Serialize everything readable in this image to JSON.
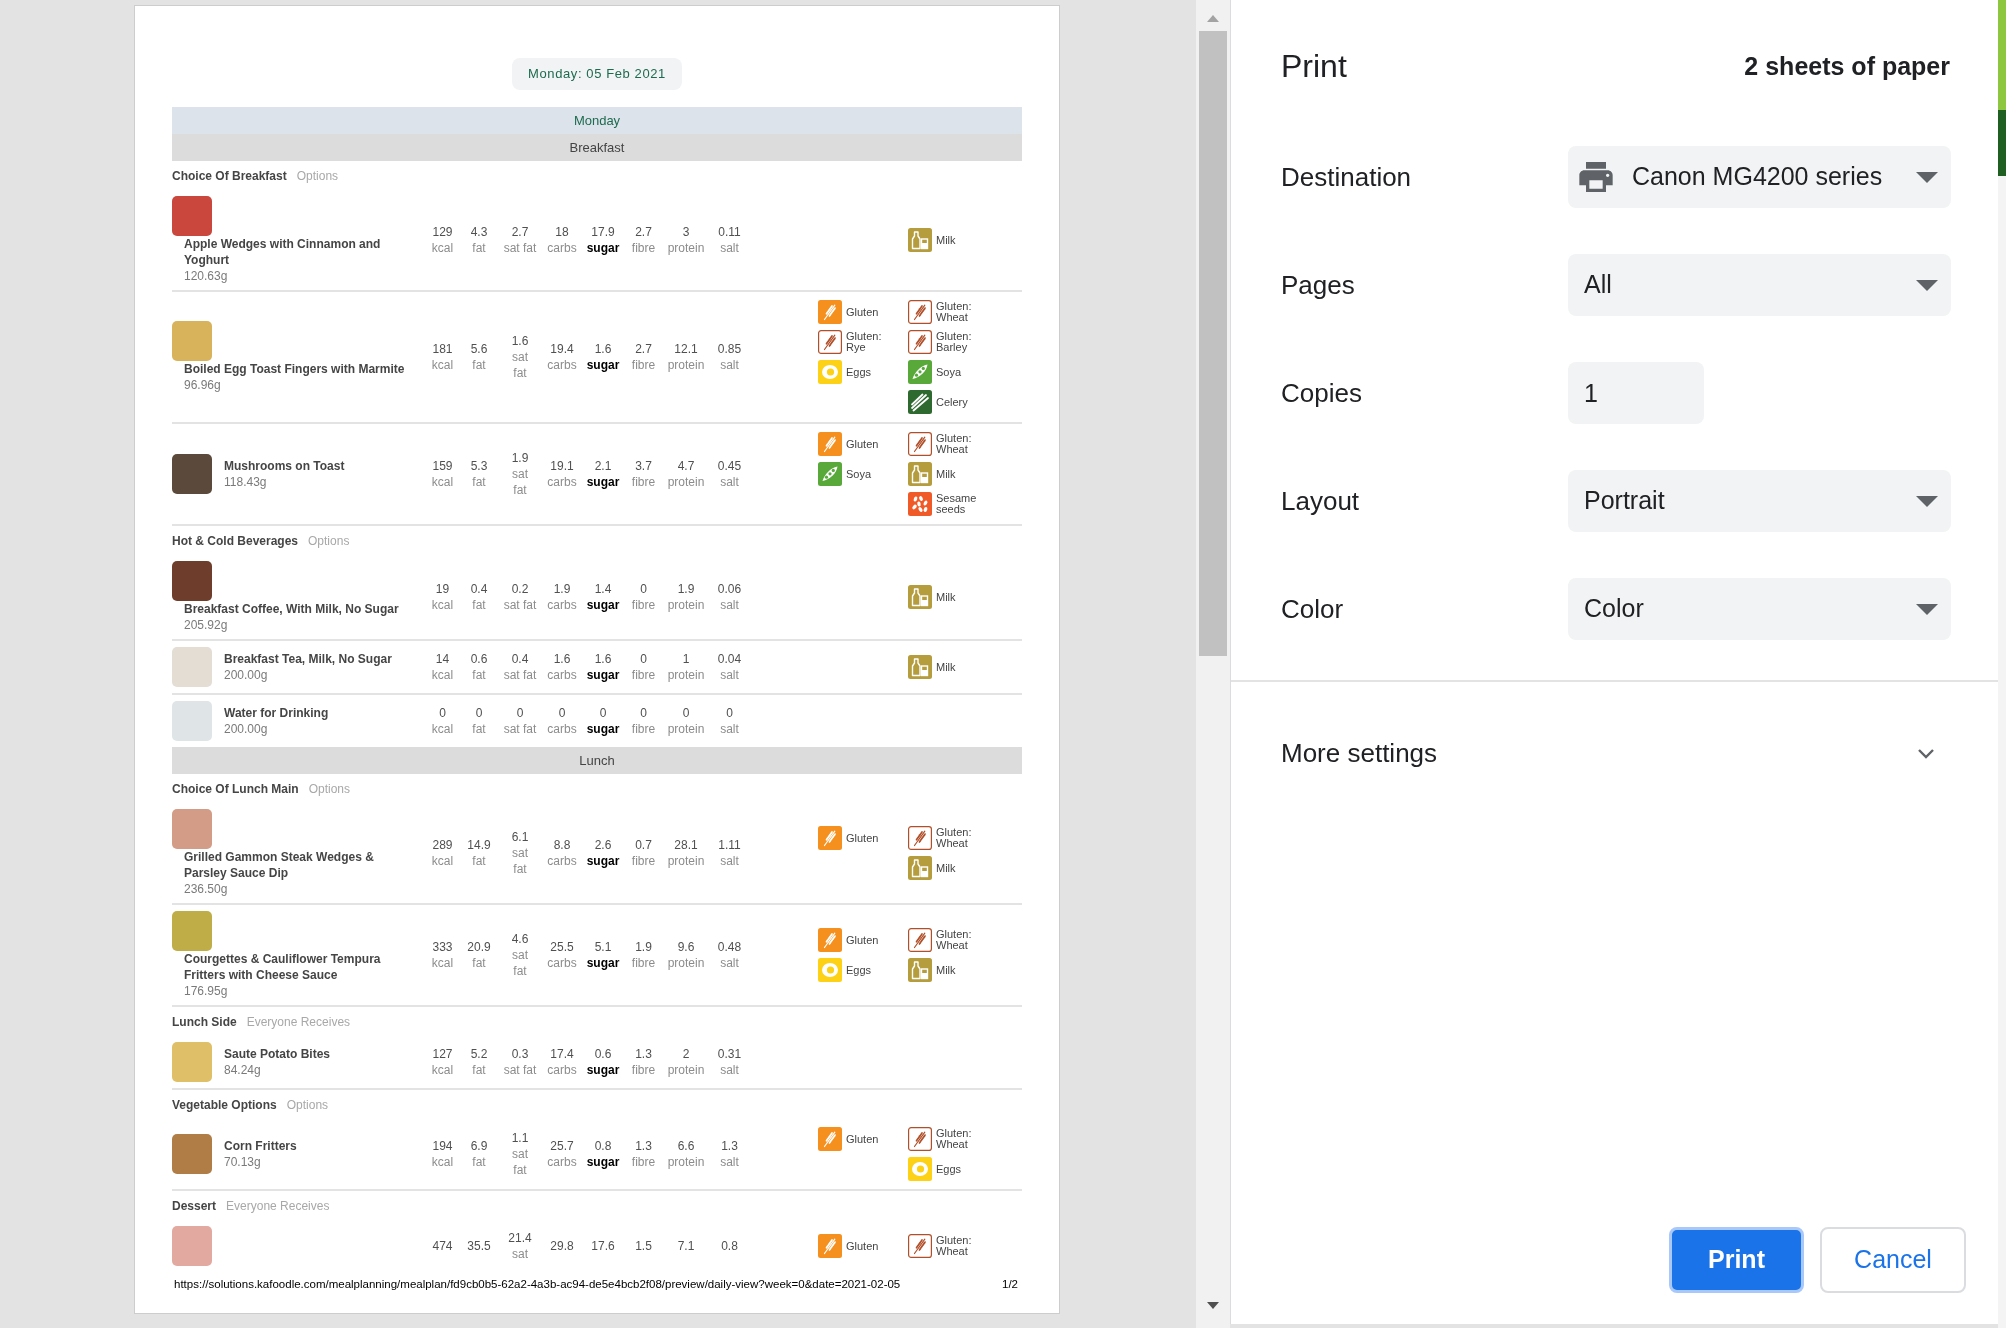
{
  "preview": {
    "date_heading": "Monday: 05 Feb 2021",
    "day": "Monday",
    "meals": [
      {
        "title": "Breakfast",
        "sections": [
          {
            "title": "Choice Of Breakfast",
            "note": "Options",
            "items": [
              {
                "name": "Apple Wedges with Cinnamon and Yoghurt",
                "weight": "120.63g",
                "nutrients": [
                  {
                    "value": "129",
                    "label": "kcal",
                    "highlighted": false
                  },
                  {
                    "value": "4.3",
                    "label": "fat",
                    "highlighted": false
                  },
                  {
                    "value": "2.7",
                    "label": "sat fat",
                    "highlighted": false
                  },
                  {
                    "value": "18",
                    "label": "carbs",
                    "highlighted": false
                  },
                  {
                    "value": "17.9",
                    "label": "sugar",
                    "highlighted": true
                  },
                  {
                    "value": "2.7",
                    "label": "fibre",
                    "highlighted": false
                  },
                  {
                    "value": "3",
                    "label": "protein",
                    "highlighted": false
                  },
                  {
                    "value": "0.11",
                    "label": "salt",
                    "highlighted": false
                  }
                ],
                "allergens_column_2": [
                  {
                    "kind": "milk",
                    "label": "Milk"
                  }
                ]
              },
              {
                "name": "Boiled Egg Toast Fingers with Marmite",
                "weight": "96.96g",
                "nutrients": [
                  {
                    "value": "181",
                    "label": "kcal",
                    "highlighted": false
                  },
                  {
                    "value": "5.6",
                    "label": "fat",
                    "highlighted": false
                  },
                  {
                    "value": "1.6",
                    "label": "sat fat",
                    "highlighted": false
                  },
                  {
                    "value": "19.4",
                    "label": "carbs",
                    "highlighted": false
                  },
                  {
                    "value": "1.6",
                    "label": "sugar",
                    "highlighted": true
                  },
                  {
                    "value": "2.7",
                    "label": "fibre",
                    "highlighted": false
                  },
                  {
                    "value": "12.1",
                    "label": "protein",
                    "highlighted": false
                  },
                  {
                    "value": "0.85",
                    "label": "salt",
                    "highlighted": false
                  }
                ],
                "allergens_column_1": [
                  {
                    "kind": "gluten",
                    "label": "Gluten"
                  },
                  {
                    "kind": "grain",
                    "label": "Gluten: Rye"
                  },
                  {
                    "kind": "eggs",
                    "label": "Eggs"
                  }
                ],
                "allergens_column_2": [
                  {
                    "kind": "grain",
                    "label": "Gluten: Wheat"
                  },
                  {
                    "kind": "grain",
                    "label": "Gluten: Barley"
                  },
                  {
                    "kind": "soya",
                    "label": "Soya"
                  },
                  {
                    "kind": "celery",
                    "label": "Celery"
                  }
                ]
              },
              {
                "name": "Mushrooms on Toast",
                "weight": "118.43g",
                "nutrients": [
                  {
                    "value": "159",
                    "label": "kcal",
                    "highlighted": false
                  },
                  {
                    "value": "5.3",
                    "label": "fat",
                    "highlighted": false
                  },
                  {
                    "value": "1.9",
                    "label": "sat fat",
                    "highlighted": false
                  },
                  {
                    "value": "19.1",
                    "label": "carbs",
                    "highlighted": false
                  },
                  {
                    "value": "2.1",
                    "label": "sugar",
                    "highlighted": true
                  },
                  {
                    "value": "3.7",
                    "label": "fibre",
                    "highlighted": false
                  },
                  {
                    "value": "4.7",
                    "label": "protein",
                    "highlighted": false
                  },
                  {
                    "value": "0.45",
                    "label": "salt",
                    "highlighted": false
                  }
                ],
                "allergens_column_1": [
                  {
                    "kind": "gluten",
                    "label": "Gluten"
                  },
                  {
                    "kind": "soya",
                    "label": "Soya"
                  }
                ],
                "allergens_column_2": [
                  {
                    "kind": "grain",
                    "label": "Gluten: Wheat"
                  },
                  {
                    "kind": "milk",
                    "label": "Milk"
                  },
                  {
                    "kind": "sesame",
                    "label": "Sesame seeds"
                  }
                ]
              }
            ]
          },
          {
            "title": "Hot & Cold Beverages",
            "note": "Options",
            "items": [
              {
                "name": "Breakfast Coffee, With Milk, No Sugar",
                "weight": "205.92g",
                "nutrients": [
                  {
                    "value": "19",
                    "label": "kcal",
                    "highlighted": false
                  },
                  {
                    "value": "0.4",
                    "label": "fat",
                    "highlighted": false
                  },
                  {
                    "value": "0.2",
                    "label": "sat fat",
                    "highlighted": false
                  },
                  {
                    "value": "1.9",
                    "label": "carbs",
                    "highlighted": false
                  },
                  {
                    "value": "1.4",
                    "label": "sugar",
                    "highlighted": true
                  },
                  {
                    "value": "0",
                    "label": "fibre",
                    "highlighted": false
                  },
                  {
                    "value": "1.9",
                    "label": "protein",
                    "highlighted": false
                  },
                  {
                    "value": "0.06",
                    "label": "salt",
                    "highlighted": false
                  }
                ],
                "allergens_column_2": [
                  {
                    "kind": "milk",
                    "label": "Milk"
                  }
                ]
              },
              {
                "name": "Breakfast Tea, Milk, No Sugar",
                "weight": "200.00g",
                "nutrients": [
                  {
                    "value": "14",
                    "label": "kcal",
                    "highlighted": false
                  },
                  {
                    "value": "0.6",
                    "label": "fat",
                    "highlighted": false
                  },
                  {
                    "value": "0.4",
                    "label": "sat fat",
                    "highlighted": false
                  },
                  {
                    "value": "1.6",
                    "label": "carbs",
                    "highlighted": false
                  },
                  {
                    "value": "1.6",
                    "label": "sugar",
                    "highlighted": true
                  },
                  {
                    "value": "0",
                    "label": "fibre",
                    "highlighted": false
                  },
                  {
                    "value": "1",
                    "label": "protein",
                    "highlighted": false
                  },
                  {
                    "value": "0.04",
                    "label": "salt",
                    "highlighted": false
                  }
                ],
                "allergens_column_2": [
                  {
                    "kind": "milk",
                    "label": "Milk"
                  }
                ]
              },
              {
                "name": "Water for Drinking",
                "weight": "200.00g",
                "nutrients": [
                  {
                    "value": "0",
                    "label": "kcal",
                    "highlighted": false
                  },
                  {
                    "value": "0",
                    "label": "fat",
                    "highlighted": false
                  },
                  {
                    "value": "0",
                    "label": "sat fat",
                    "highlighted": false
                  },
                  {
                    "value": "0",
                    "label": "carbs",
                    "highlighted": false
                  },
                  {
                    "value": "0",
                    "label": "sugar",
                    "highlighted": true
                  },
                  {
                    "value": "0",
                    "label": "fibre",
                    "highlighted": false
                  },
                  {
                    "value": "0",
                    "label": "protein",
                    "highlighted": false
                  },
                  {
                    "value": "0",
                    "label": "salt",
                    "highlighted": false
                  }
                ]
              }
            ]
          }
        ]
      },
      {
        "title": "Lunch",
        "sections": [
          {
            "title": "Choice Of Lunch Main",
            "note": "Options",
            "items": [
              {
                "name": "Grilled Gammon Steak Wedges & Parsley Sauce Dip",
                "weight": "236.50g",
                "nutrients": [
                  {
                    "value": "289",
                    "label": "kcal",
                    "highlighted": false
                  },
                  {
                    "value": "14.9",
                    "label": "fat",
                    "highlighted": false
                  },
                  {
                    "value": "6.1",
                    "label": "sat fat",
                    "highlighted": false
                  },
                  {
                    "value": "8.8",
                    "label": "carbs",
                    "highlighted": false
                  },
                  {
                    "value": "2.6",
                    "label": "sugar",
                    "highlighted": true
                  },
                  {
                    "value": "0.7",
                    "label": "fibre",
                    "highlighted": false
                  },
                  {
                    "value": "28.1",
                    "label": "protein",
                    "highlighted": false
                  },
                  {
                    "value": "1.11",
                    "label": "salt",
                    "highlighted": false
                  }
                ],
                "allergens_column_1": [
                  {
                    "kind": "gluten",
                    "label": "Gluten"
                  }
                ],
                "allergens_column_2": [
                  {
                    "kind": "grain",
                    "label": "Gluten: Wheat"
                  },
                  {
                    "kind": "milk",
                    "label": "Milk"
                  }
                ]
              },
              {
                "name": "Courgettes & Cauliflower Tempura Fritters with Cheese Sauce",
                "weight": "176.95g",
                "nutrients": [
                  {
                    "value": "333",
                    "label": "kcal",
                    "highlighted": false
                  },
                  {
                    "value": "20.9",
                    "label": "fat",
                    "highlighted": false
                  },
                  {
                    "value": "4.6",
                    "label": "sat fat",
                    "highlighted": false
                  },
                  {
                    "value": "25.5",
                    "label": "carbs",
                    "highlighted": false
                  },
                  {
                    "value": "5.1",
                    "label": "sugar",
                    "highlighted": true
                  },
                  {
                    "value": "1.9",
                    "label": "fibre",
                    "highlighted": false
                  },
                  {
                    "value": "9.6",
                    "label": "protein",
                    "highlighted": false
                  },
                  {
                    "value": "0.48",
                    "label": "salt",
                    "highlighted": false
                  }
                ],
                "allergens_column_1": [
                  {
                    "kind": "gluten",
                    "label": "Gluten"
                  },
                  {
                    "kind": "eggs",
                    "label": "Eggs"
                  }
                ],
                "allergens_column_2": [
                  {
                    "kind": "grain",
                    "label": "Gluten: Wheat"
                  },
                  {
                    "kind": "milk",
                    "label": "Milk"
                  }
                ]
              }
            ]
          },
          {
            "title": "Lunch Side",
            "note": "Everyone Receives",
            "items": [
              {
                "name": "Saute Potato Bites",
                "weight": "84.24g",
                "nutrients": [
                  {
                    "value": "127",
                    "label": "kcal",
                    "highlighted": false
                  },
                  {
                    "value": "5.2",
                    "label": "fat",
                    "highlighted": false
                  },
                  {
                    "value": "0.3",
                    "label": "sat fat",
                    "highlighted": false
                  },
                  {
                    "value": "17.4",
                    "label": "carbs",
                    "highlighted": false
                  },
                  {
                    "value": "0.6",
                    "label": "sugar",
                    "highlighted": true
                  },
                  {
                    "value": "1.3",
                    "label": "fibre",
                    "highlighted": false
                  },
                  {
                    "value": "2",
                    "label": "protein",
                    "highlighted": false
                  },
                  {
                    "value": "0.31",
                    "label": "salt",
                    "highlighted": false
                  }
                ]
              }
            ]
          },
          {
            "title": "Vegetable Options",
            "note": "Options",
            "items": [
              {
                "name": "Corn Fritters",
                "weight": "70.13g",
                "nutrients": [
                  {
                    "value": "194",
                    "label": "kcal",
                    "highlighted": false
                  },
                  {
                    "value": "6.9",
                    "label": "fat",
                    "highlighted": false
                  },
                  {
                    "value": "1.1",
                    "label": "sat fat",
                    "highlighted": false
                  },
                  {
                    "value": "25.7",
                    "label": "carbs",
                    "highlighted": false
                  },
                  {
                    "value": "0.8",
                    "label": "sugar",
                    "highlighted": true
                  },
                  {
                    "value": "1.3",
                    "label": "fibre",
                    "highlighted": false
                  },
                  {
                    "value": "6.6",
                    "label": "protein",
                    "highlighted": false
                  },
                  {
                    "value": "1.3",
                    "label": "salt",
                    "highlighted": false
                  }
                ],
                "allergens_column_1": [
                  {
                    "kind": "gluten",
                    "label": "Gluten"
                  }
                ],
                "allergens_column_2": [
                  {
                    "kind": "grain",
                    "label": "Gluten: Wheat"
                  },
                  {
                    "kind": "eggs",
                    "label": "Eggs"
                  }
                ]
              }
            ]
          },
          {
            "title": "Dessert",
            "note": "Everyone Receives",
            "items": [
              {
                "nutrients": [
                  {
                    "value": "474"
                  },
                  {
                    "value": "35.5"
                  },
                  {
                    "value": "21.4",
                    "label": "sat"
                  },
                  {
                    "value": "29.8"
                  },
                  {
                    "value": "17.6"
                  },
                  {
                    "value": "1.5"
                  },
                  {
                    "value": "7.1"
                  },
                  {
                    "value": "0.8"
                  }
                ],
                "allergens_column_1": [
                  {
                    "kind": "gluten",
                    "label": "Gluten"
                  }
                ],
                "allergens_column_2": [
                  {
                    "kind": "grain",
                    "label": "Gluten: Wheat"
                  }
                ]
              }
            ]
          }
        ]
      }
    ],
    "footer": {
      "url": "https://solutions.kafoodle.com/mealplanning/mealplan/fd9cb0b5-62a2-4a3b-ac94-de5e4bcb2f08/preview/daily-view?week=0&date=2021-02-05",
      "page": "1/2"
    }
  },
  "print_panel": {
    "title": "Print",
    "summary": "2 sheets of paper",
    "settings": [
      {
        "label": "Destination",
        "kind": "destination",
        "value": "Canon MG4200 series"
      },
      {
        "label": "Pages",
        "kind": "select",
        "value": "All"
      },
      {
        "label": "Copies",
        "kind": "number",
        "value": "1"
      },
      {
        "label": "Layout",
        "kind": "select",
        "value": "Portrait"
      },
      {
        "label": "Color",
        "kind": "select",
        "value": "Color"
      }
    ],
    "more_settings": {
      "label": "More settings",
      "expanded": false
    },
    "buttons": [
      {
        "label": "Print",
        "kind": "primary",
        "focused": true
      },
      {
        "label": "Cancel",
        "kind": "secondary",
        "focused": false
      }
    ]
  }
}
